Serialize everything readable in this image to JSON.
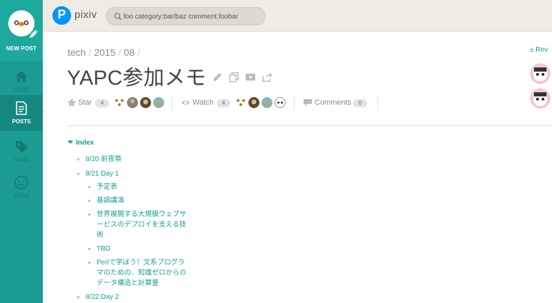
{
  "sidebar": {
    "new_post_label": "NEW POST",
    "items": [
      {
        "label": "HOME",
        "icon": "home-icon"
      },
      {
        "label": "POSTS",
        "icon": "document-icon",
        "active": true
      },
      {
        "label": "TAGS",
        "icon": "tag-icon"
      },
      {
        "label": "TEAM",
        "icon": "team-icon"
      }
    ],
    "colors": {
      "background": "#1b9c92",
      "active": "#16877f"
    }
  },
  "topbar": {
    "logo_letter": "P",
    "logo_text": "pixiv",
    "search": {
      "value": "foo category:bar/baz comment:foobar",
      "icon": "search-icon"
    }
  },
  "breadcrumb": [
    "tech",
    "2015",
    "08"
  ],
  "post": {
    "title": "YAPC参加メモ",
    "actions": [
      "edit-icon",
      "copy-icon",
      "slideshow-icon",
      "share-icon"
    ],
    "star": {
      "label": "Star",
      "count": "4"
    },
    "watch": {
      "label": "Watch",
      "count": "4"
    },
    "comments": {
      "label": "Comments",
      "count": "0"
    }
  },
  "index": {
    "heading": "Index",
    "items": [
      {
        "text": "8/20 前夜祭",
        "level": 1
      },
      {
        "text": "8/21 Day 1",
        "level": 1
      },
      {
        "text": "予定表",
        "level": 2
      },
      {
        "text": "基調講演",
        "level": 2
      },
      {
        "text": "世界展開する大規模ウェブサ",
        "level": 2
      },
      {
        "text": "ービスのデプロイを支える技",
        "level": 2,
        "continuation": true
      },
      {
        "text": "術",
        "level": 2,
        "continuation": true
      },
      {
        "text": "TBD",
        "level": 2
      },
      {
        "text": "Perlで学ぼう！文系プログラ",
        "level": 2
      },
      {
        "text": "マのための、知識ゼロからの",
        "level": 2,
        "continuation": true
      },
      {
        "text": "データ構造と計算量",
        "level": 2,
        "continuation": true
      },
      {
        "text": "8/22 Day 2",
        "level": 1
      }
    ]
  },
  "right_panel": {
    "revision_label": "Rev"
  },
  "colors": {
    "accent": "#1a9c91",
    "topbar": "#eeece3"
  }
}
